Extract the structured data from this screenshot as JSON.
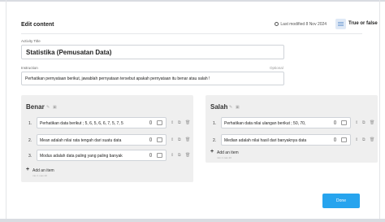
{
  "header": {
    "title": "Edit content",
    "last_modified": "Last modified 8 Nov 2024",
    "template_name": "True or false"
  },
  "activity_title": {
    "label": "Activity Title",
    "value": "Statistika (Pemusatan Data)"
  },
  "instruction": {
    "label": "Instruction",
    "optional": "Optional",
    "value": "Perhatikan pernyataan berikut, jawablah pernyataan tersebut apakah pernyataan itu benar atau salah !"
  },
  "groups": [
    {
      "title": "Benar",
      "items": [
        {
          "num": "1.",
          "text": "Perhatikan data berikut ; 5, 6, 5, 6, 6, 7, 5, 7, 5"
        },
        {
          "num": "2.",
          "text": "Mean adalah nilai rata tengah dari suatu data"
        },
        {
          "num": "3.",
          "text": "Modus adalah data paling yang paling banyak"
        }
      ],
      "add_label": "Add an item",
      "add_sub": "min 1   max 20"
    },
    {
      "title": "Salah",
      "items": [
        {
          "num": "1.",
          "text": "Perhatikan data nilai ulangan berikut ; 50, 70,"
        },
        {
          "num": "2.",
          "text": "Median adalah nilai hasil dari banyaknya data"
        }
      ],
      "add_label": "Add an item",
      "add_sub": "min 1   max 20"
    }
  ],
  "done_label": "Done"
}
